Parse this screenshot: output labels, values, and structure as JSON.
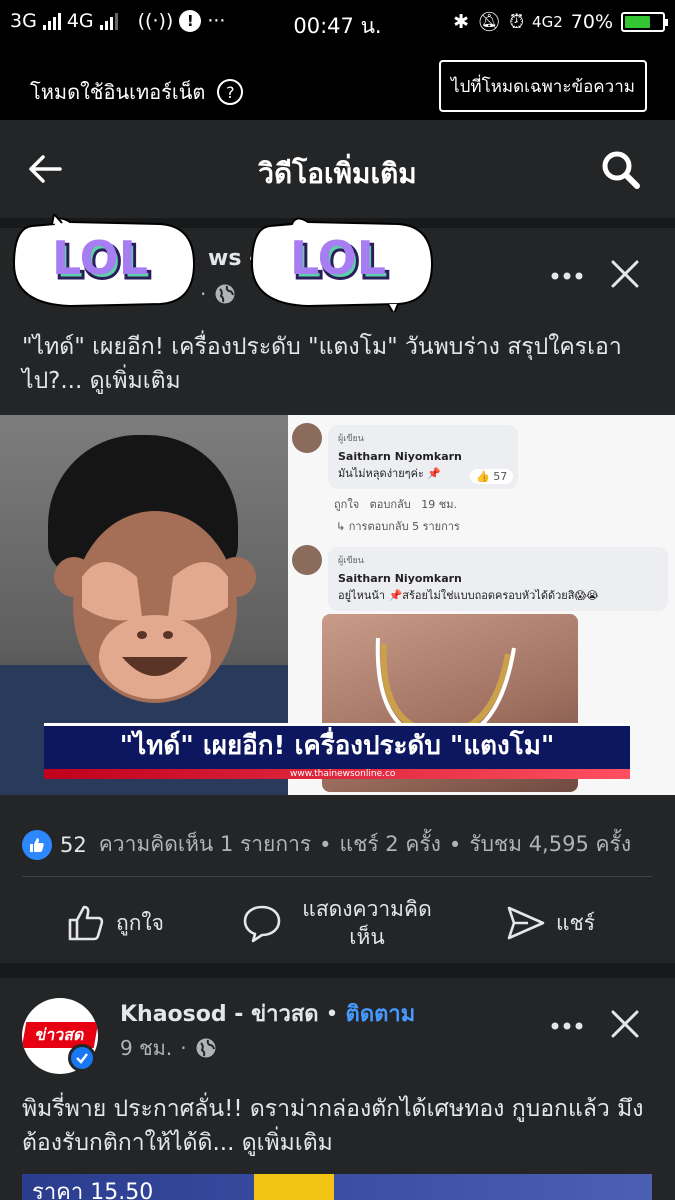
{
  "status_bar": {
    "network_left": "3G",
    "network_mid": "4G",
    "time": "00:47 น.",
    "network_right": "4G2",
    "battery_percent": "70%",
    "battery_level": 0.7
  },
  "data_mode": {
    "label": "โหมดใช้อินเทอร์เน็ต",
    "help": "?",
    "button": "ไปที่โหมดเฉพาะข้อความ"
  },
  "header": {
    "title": "วิดีโอเพิ่มเติม"
  },
  "post1": {
    "page_name_partial": "ws -",
    "meta_partial": "·",
    "sticker_text": "LOL",
    "text": "\"ไทด์\" เผยอีก! เครื่องประดับ \"แตงโม\" วันพบร่าง สรุปใครเอาไป?...",
    "see_more": "ดูเพิ่มเติม",
    "media": {
      "comment1_tag": "ผู้เขียน",
      "comment1_author": "Saitharn Niyomkarn",
      "comment1_text": "มันไม่หลุดง่ายๆค่ะ 📌",
      "comment1_reactions": "57",
      "comment1_like": "ถูกใจ",
      "comment1_reply": "ตอบกลับ",
      "comment1_time": "19 ชม.",
      "comment1_replies": "↳ การตอบกลับ 5 รายการ",
      "comment2_tag": "ผู้เขียน",
      "comment2_author": "Saitharn Niyomkarn",
      "comment2_text": "อยู่ไหนน้า 📌สร้อยไม่ใช่แบบถอดครอบหัวได้ด้วยสิ😱😭",
      "headline": "\"ไทด์\" เผยอีก! เครื่องประดับ \"แตงโม\"",
      "source": "www.thainewsonline.co"
    },
    "reactions": "52",
    "comments": "ความคิดเห็น 1 รายการ",
    "shares": "แชร์ 2 ครั้ง",
    "views": "รับชม 4,595 ครั้ง",
    "sep": "•",
    "actions": {
      "like": "ถูกใจ",
      "comment": "แสดงความคิดเห็น",
      "share": "แชร์"
    }
  },
  "post2": {
    "avatar_text": "ข่าวสด",
    "page_name": "Khaosod - ข่าวสด",
    "sep": "•",
    "follow": "ติดตาม",
    "time": "9 ชม.",
    "sep2": "·",
    "text": "พิมรี่พาย ประกาศลั่น!! ดราม่ากล่องตักได้เศษทอง กูบอกแล้ว มึงต้องรับกติกาให้ได้ดิ...",
    "see_more": "ดูเพิ่มเติม",
    "image_text": "ราคา 15.50"
  }
}
